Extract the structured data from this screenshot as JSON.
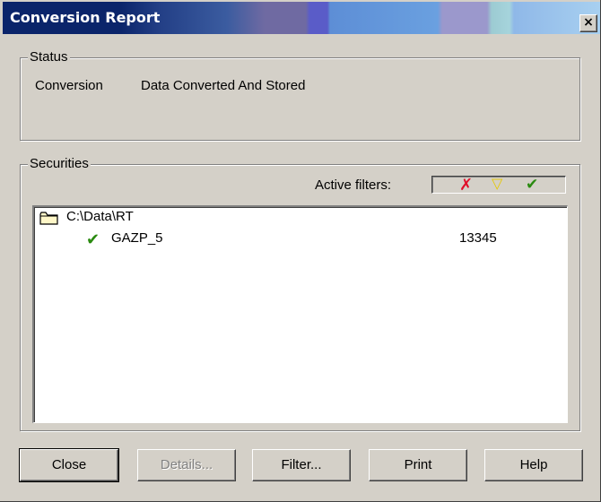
{
  "window": {
    "title": "Conversion Report",
    "close_glyph": "×"
  },
  "status": {
    "legend": "Status",
    "label": "Conversion",
    "value": "Data Converted And Stored"
  },
  "securities": {
    "legend": "Securities",
    "active_filters_label": "Active filters:",
    "filters": [
      {
        "icon": "red-x-icon",
        "glyph": "✗",
        "color": "#e0102a"
      },
      {
        "icon": "yellow-triangle-icon",
        "glyph": "▽",
        "color": "#e6c800"
      },
      {
        "icon": "green-check-icon",
        "glyph": "✔",
        "color": "#2a8a10"
      }
    ],
    "folder": "C:\\Data\\RT",
    "items": [
      {
        "name": "GAZP_5",
        "count": "13345"
      }
    ]
  },
  "buttons": {
    "close": "Close",
    "details": "Details...",
    "filter": "Filter...",
    "print": "Print",
    "help": "Help"
  }
}
